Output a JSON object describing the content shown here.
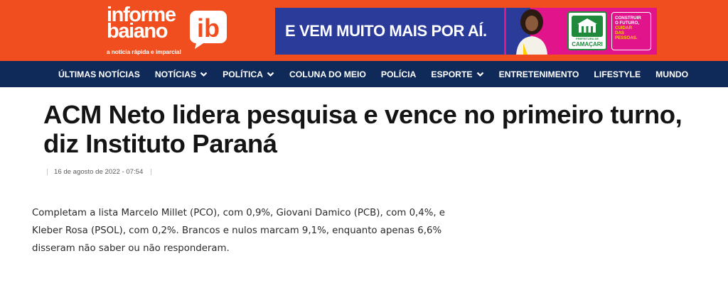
{
  "brand": {
    "logo_line1": "informe",
    "logo_line2": "baiano",
    "logo_mark": "ib",
    "tagline": "a notícia rápida e imparcial",
    "colors": {
      "header": "#f14e1f",
      "nav": "#0f2a58",
      "ad_bg": "#2a3b9a",
      "ad_accent": "#e2148c"
    }
  },
  "ad": {
    "headline": "E VEM MUITO MAIS POR AÍ.",
    "seal_small": "PREFEITURA DE",
    "seal_city": "CAMAÇARI",
    "slogan_line1": "CONSTRUIR",
    "slogan_line2": "O FUTURO,",
    "slogan_line3": "CUIDAR",
    "slogan_line4": "DAS PESSOAS."
  },
  "nav": {
    "items": [
      {
        "label": "ÚLTIMAS NOTÍCIAS",
        "dropdown": false
      },
      {
        "label": "NOTÍCIAS",
        "dropdown": true
      },
      {
        "label": "POLÍTICA",
        "dropdown": true
      },
      {
        "label": "COLUNA DO MEIO",
        "dropdown": false
      },
      {
        "label": "POLÍCIA",
        "dropdown": false
      },
      {
        "label": "ESPORTE",
        "dropdown": true
      },
      {
        "label": "ENTRETENIMENTO",
        "dropdown": false
      },
      {
        "label": "LIFESTYLE",
        "dropdown": false
      },
      {
        "label": "MUNDO",
        "dropdown": false
      }
    ]
  },
  "article": {
    "title_line1": "ACM Neto lidera pesquisa e vence no primeiro turno,",
    "title_line2": "diz Instituto Paraná",
    "date": "16 de agosto de 2022 - 07:54",
    "body_line1": "Completam a lista Marcelo Millet (PCO), com 0,9%, Giovani Damico (PCB), com 0,4%, e",
    "body_line2": "Kleber Rosa (PSOL), com 0,2%. Brancos e nulos marcam 9,1%, enquanto apenas 6,6%",
    "body_line3": "disseram não saber ou não responderam."
  }
}
